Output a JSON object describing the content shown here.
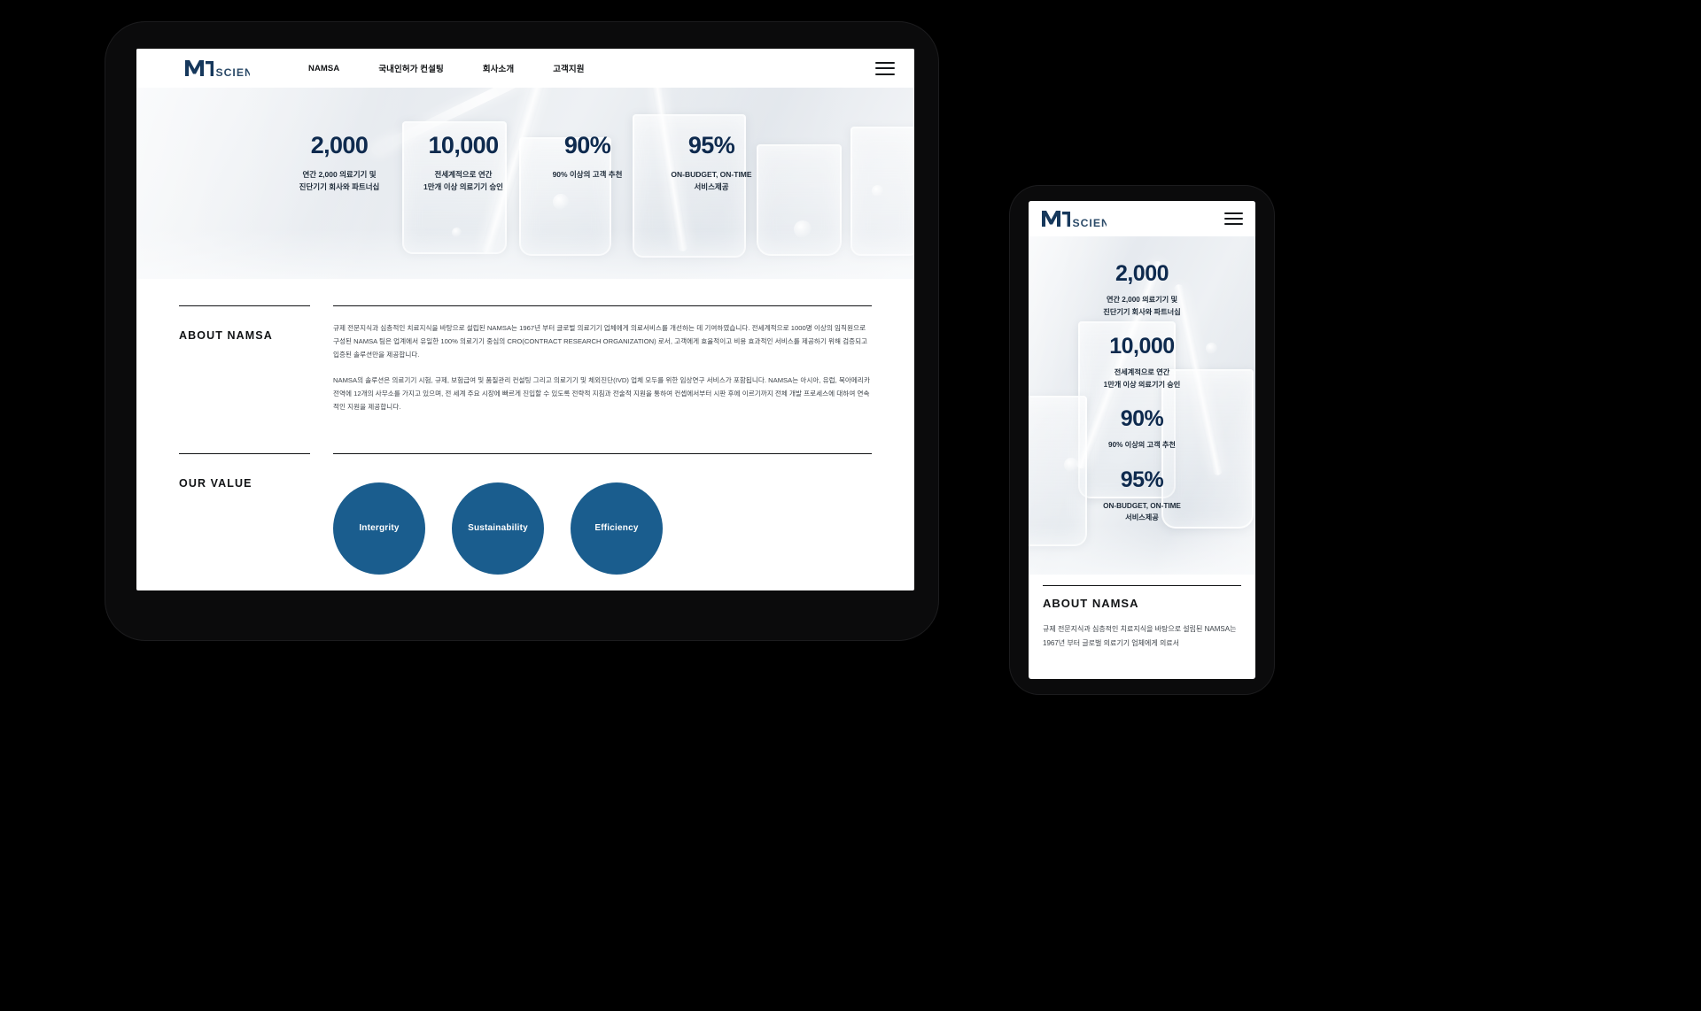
{
  "brand": {
    "logo_mark": "MD",
    "logo_word": "SCIENCE",
    "accent_navy": "#0e2a4e",
    "accent_blue": "#1a5d8e"
  },
  "nav": {
    "items": [
      {
        "label": "NAMSA"
      },
      {
        "label": "국내인허가 컨설팅"
      },
      {
        "label": "회사소개"
      },
      {
        "label": "고객지원"
      }
    ],
    "menu_icon": "hamburger-icon"
  },
  "hero": {
    "stats": [
      {
        "value": "2,000",
        "label": "연간 2,000 의료기기 및\n진단기기 회사와 파트너십"
      },
      {
        "value": "10,000",
        "label": "전세계적으로 연간\n1만개 이상 의료기기 승인"
      },
      {
        "value": "90%",
        "label": "90% 이상의 고객 추천"
      },
      {
        "value": "95%",
        "label": "ON-BUDGET, ON-TIME\n서비스제공"
      }
    ]
  },
  "about": {
    "title": "ABOUT NAMSA",
    "paragraph1": "규제 전문지식과 심층적인 치료지식을 바탕으로 설립된 NAMSA는 1967년 부터 글로벌 의료기기 업체에게 의료서비스를 개선하는 데 기여하였습니다. 전세계적으로 1000명 이상의 임직원으로 구성된 NAMSA 팀은 업계에서 유일한 100% 의료기기 중심의 CRO(CONTRACT RESEARCH ORGANIZATION) 로서, 고객에게 효율적이고 비용 효과적인 서비스를 제공하기 위해 검증되고 입증된 솔루션만을 제공합니다.",
    "paragraph2": "NAMSA의 솔루션은 의료기기 시험, 규제, 보험급여 및 품질관리 컨설팅 그리고 의료기기 및 체외진단(IVD) 업체 모두를 위한 임상연구 서비스가 포함됩니다. NAMSA는 아시아, 유럽, 북아메리카 전역에 12개의 사무소를 가지고 있으며, 전 세계 주요 시장에 빠르게 진입할 수 있도록 전략적 지침과 전술적 지원을 통하여 컨셉에서부터 시판 후에 이르기까지 전체 개발 프로세스에 대하여 연속적인 지원을 제공합니다."
  },
  "value": {
    "title": "OUR VALUE",
    "circles": [
      {
        "label": "Intergrity"
      },
      {
        "label": "Sustainability"
      },
      {
        "label": "Efficiency"
      }
    ]
  },
  "mobile": {
    "stats": [
      {
        "value": "2,000",
        "label": "연간 2,000 의료기기 및\n진단기기 회사와 파트너십"
      },
      {
        "value": "10,000",
        "label": "전세계적으로 연간\n1만개 이상 의료기기 승인"
      },
      {
        "value": "90%",
        "label": "90% 이상의 고객 추천"
      },
      {
        "value": "95%",
        "label": "ON-BUDGET, ON-TIME\n서비스제공"
      }
    ],
    "about_title": "ABOUT NAMSA",
    "about_excerpt": "규제 전문지식과 심층적인 치료지식을 바탕으로 설립된 NAMSA는 1967년 부터 글로벌 의료기기 업체에게 의료서"
  }
}
